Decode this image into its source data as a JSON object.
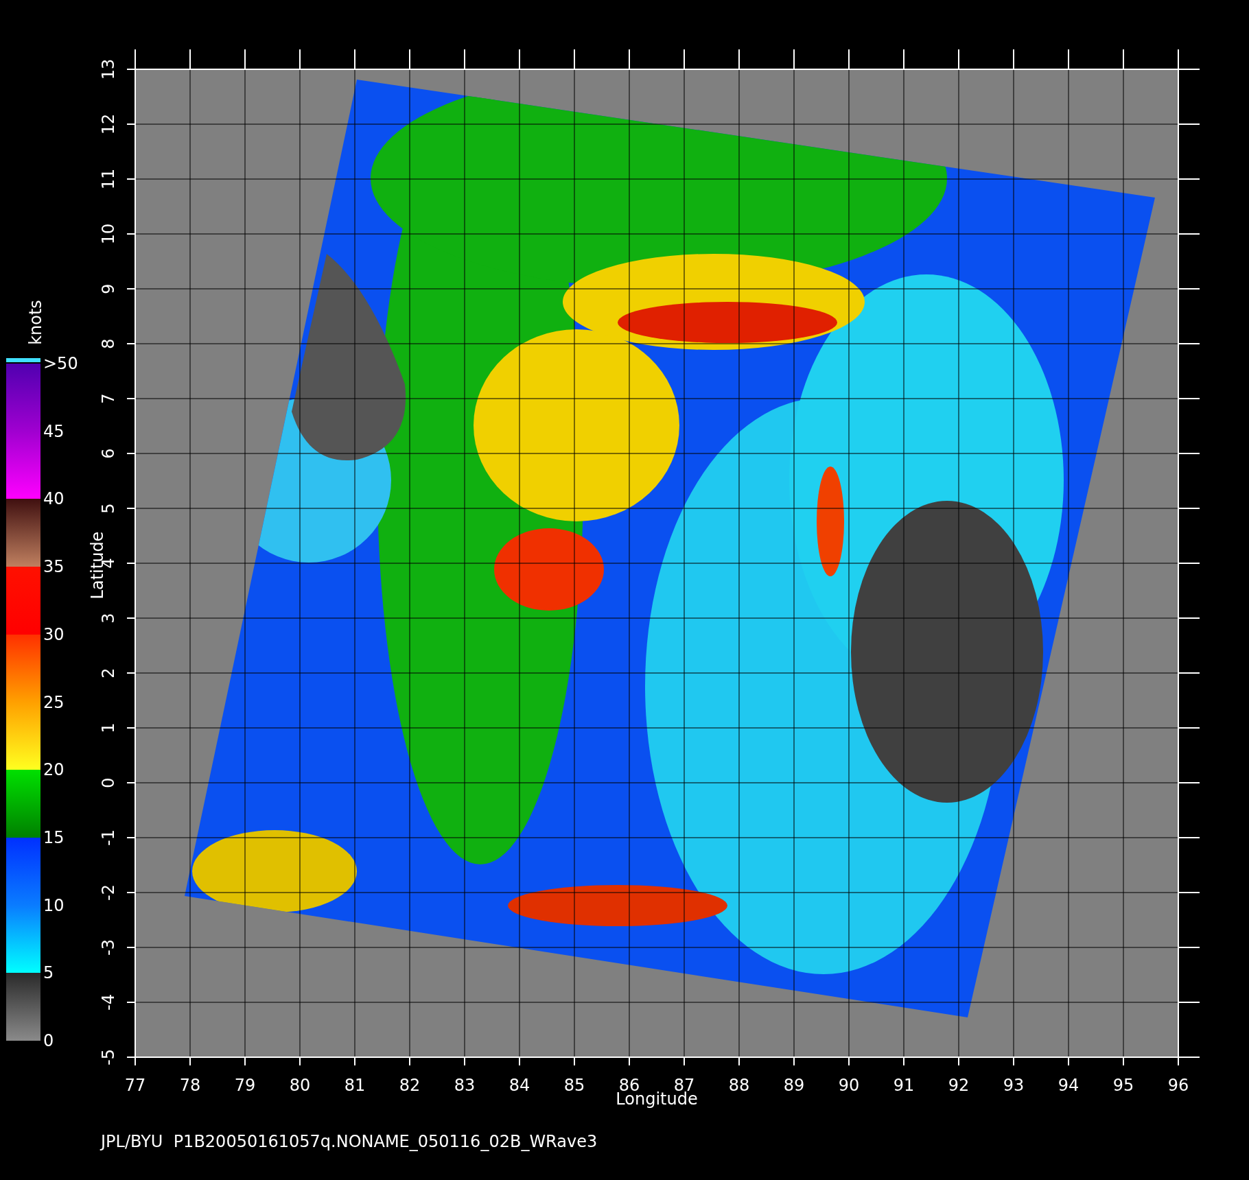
{
  "plot": {
    "x_axis": {
      "label": "Longitude",
      "ticks": [
        "77",
        "78",
        "79",
        "80",
        "81",
        "82",
        "83",
        "84",
        "85",
        "86",
        "87",
        "88",
        "89",
        "90",
        "91",
        "92",
        "93",
        "94",
        "95",
        "96"
      ]
    },
    "y_axis": {
      "label": "Latitude",
      "ticks": [
        "13",
        "12",
        "11",
        "10",
        "9",
        "8",
        "7",
        "6",
        "5",
        "4",
        "3",
        "2",
        "1",
        "0",
        "-1",
        "-2",
        "-3",
        "-4",
        "-5"
      ]
    }
  },
  "colorbar": {
    "title": "knots",
    "labels": [
      ">50",
      "45",
      "40",
      "35",
      "30",
      "25",
      "20",
      "15",
      "10",
      "5",
      "0"
    ]
  },
  "caption": "JPL/BYU  P1B20050161057q.NONAME_050116_02B_WRave3"
}
